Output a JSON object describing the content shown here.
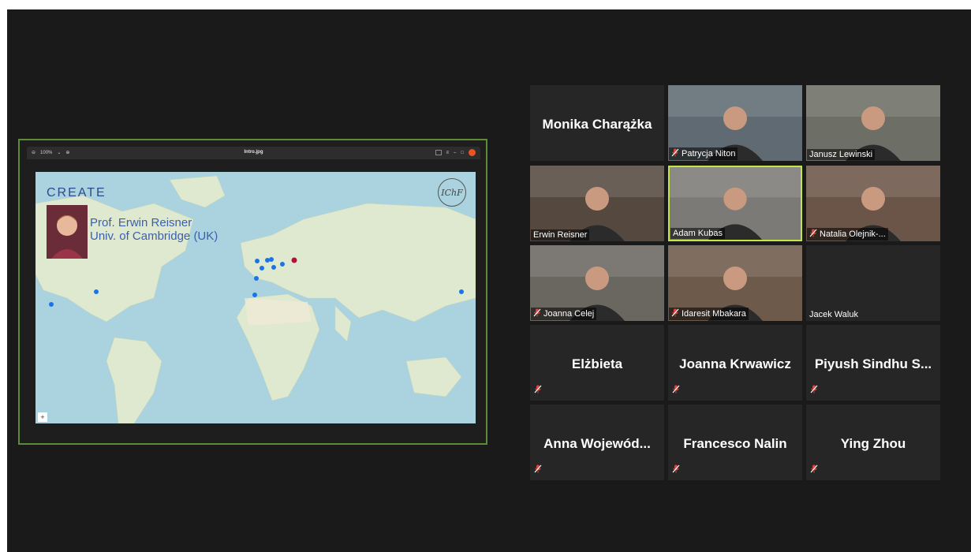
{
  "share": {
    "toolbar": {
      "zoom_level": "100%",
      "file_name": "Intro.jpg"
    },
    "slide": {
      "brand": "CREATE",
      "speaker_name": "Prof. Erwin Reisner",
      "speaker_affiliation": "Univ. of Cambridge (UK)",
      "logo_text": "IChF",
      "map_zoom_control": "+"
    }
  },
  "participants": [
    {
      "name": "Monika Charążka",
      "video": false,
      "muted": false
    },
    {
      "name": "Patrycja Niton",
      "video": true,
      "muted": true
    },
    {
      "name": "Janusz Lewinski",
      "video": true,
      "muted": false
    },
    {
      "name": "Erwin Reisner",
      "video": true,
      "muted": false
    },
    {
      "name": "Adam Kubas",
      "video": true,
      "muted": false,
      "active_speaker": true
    },
    {
      "name": "Natalia Olejnik-...",
      "video": true,
      "muted": true
    },
    {
      "name": "Joanna Celej",
      "video": true,
      "muted": true
    },
    {
      "name": "Idaresit Mbakara",
      "video": true,
      "muted": true
    },
    {
      "name": "Jacek Waluk",
      "video": "blank",
      "muted": false
    },
    {
      "name": "Elżbieta",
      "video": false,
      "muted": true
    },
    {
      "name": "Joanna Krwawicz",
      "video": false,
      "muted": true
    },
    {
      "name": "Piyush Sindhu S...",
      "video": false,
      "muted": true
    },
    {
      "name": "Anna  Wojewód...",
      "video": false,
      "muted": true
    },
    {
      "name": "Francesco Nalin",
      "video": false,
      "muted": true
    },
    {
      "name": "Ying Zhou",
      "video": false,
      "muted": true
    }
  ],
  "colors": {
    "background": "#1a1a1a",
    "tile": "#262626",
    "share_border": "#5c8c34",
    "active_speaker_border": "#c7e34a",
    "muted_icon": "#e0443c",
    "map_pin": "#1a73e8",
    "map_pin_highlight": "#b3123e"
  }
}
